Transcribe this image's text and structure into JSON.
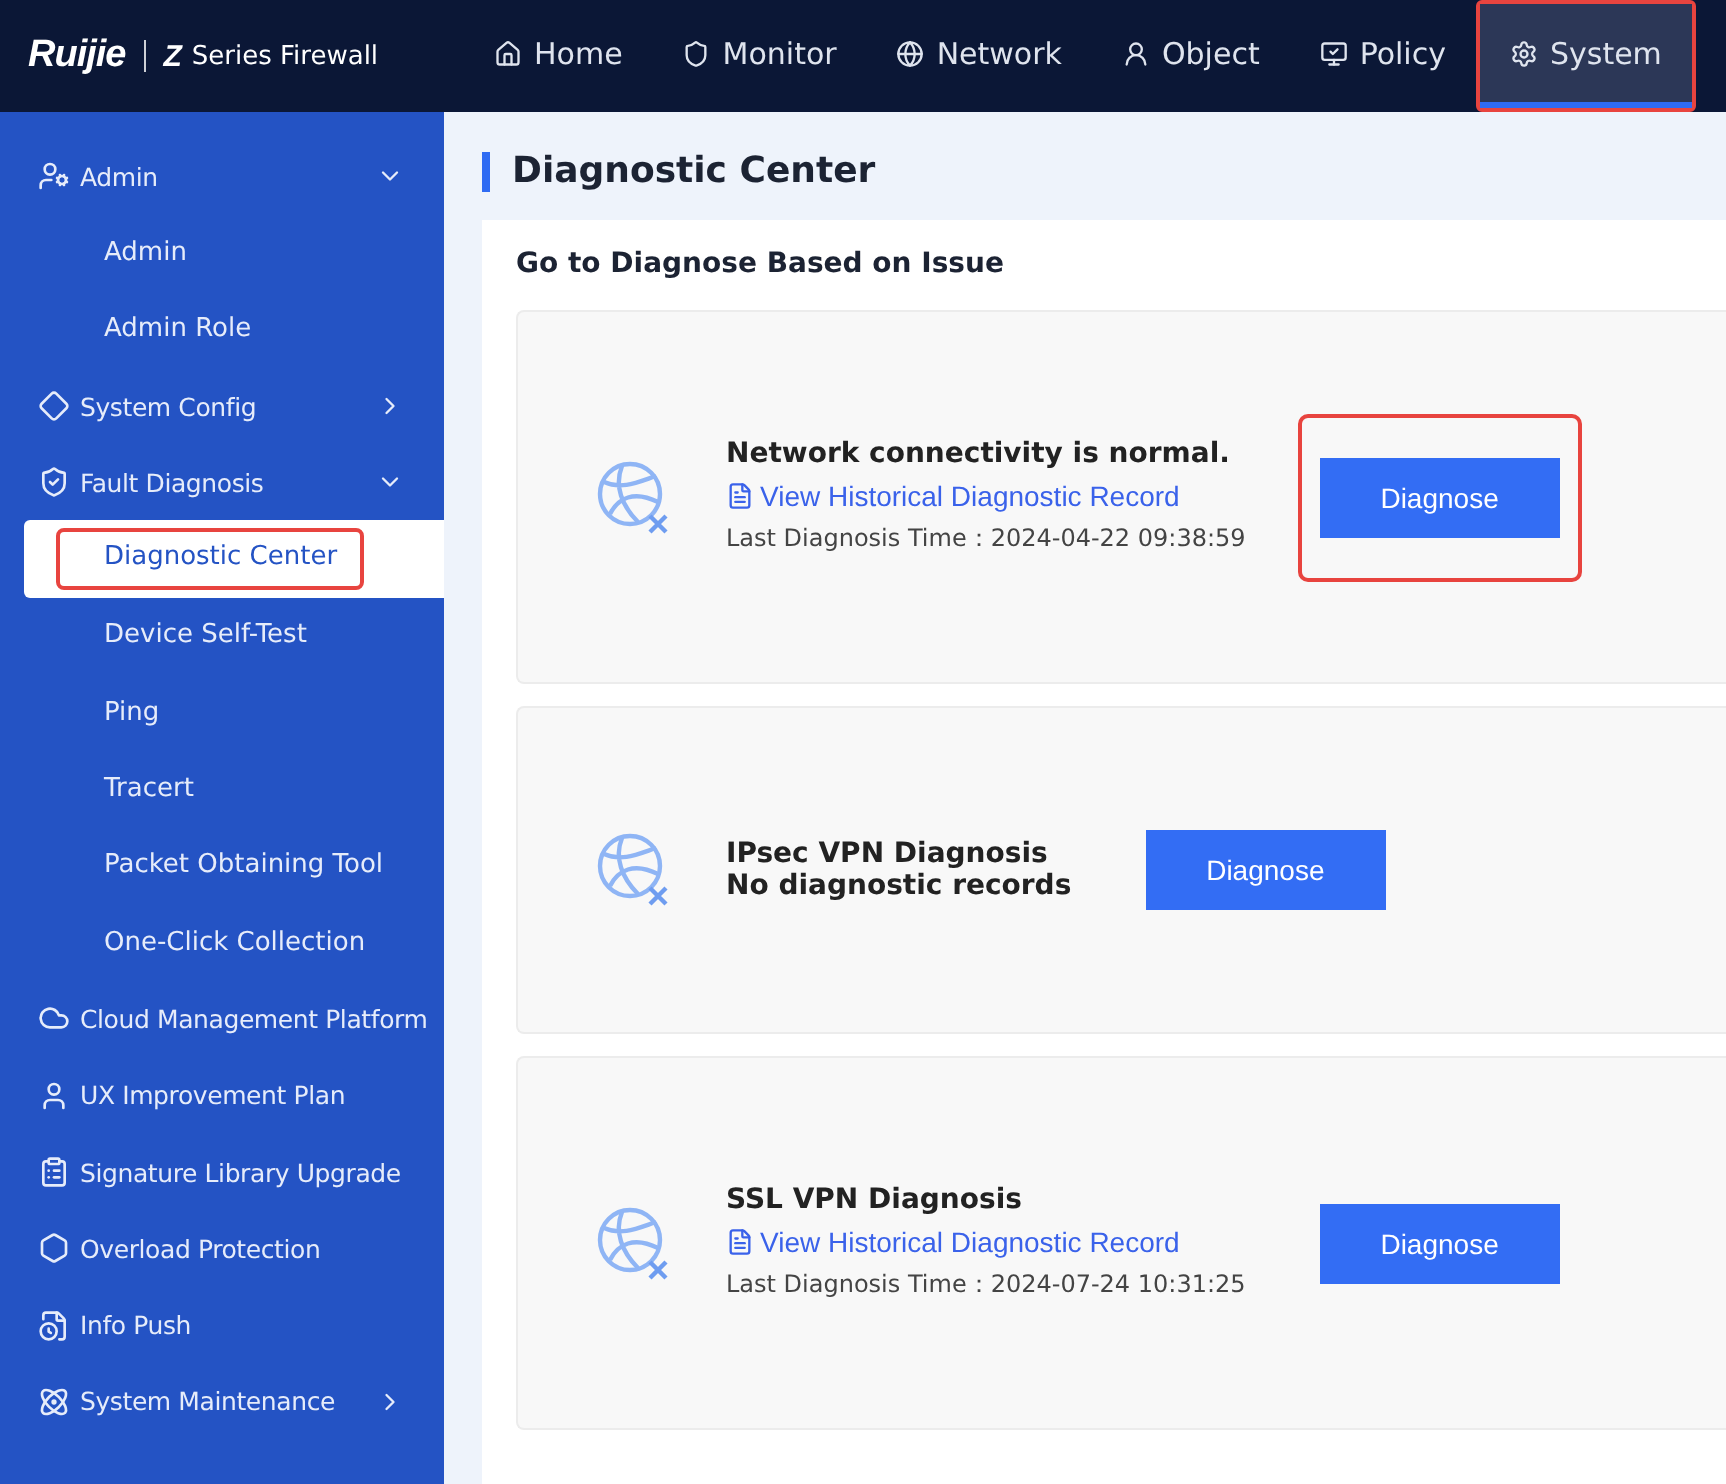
{
  "header": {
    "logo": "Ruijie",
    "product_mark": "Z",
    "product": "Series Firewall"
  },
  "nav": [
    {
      "label": "Home",
      "selected": false,
      "highlighted": false
    },
    {
      "label": "Monitor",
      "selected": false,
      "highlighted": false
    },
    {
      "label": "Network",
      "selected": false,
      "highlighted": false
    },
    {
      "label": "Object",
      "selected": false,
      "highlighted": false
    },
    {
      "label": "Policy",
      "selected": false,
      "highlighted": false
    },
    {
      "label": "System",
      "selected": true,
      "highlighted": true
    }
  ],
  "sidebar": [
    {
      "kind": "group",
      "label": "Admin",
      "expanded": true,
      "children": [
        {
          "label": "Admin",
          "selected": false,
          "highlighted": false
        },
        {
          "label": "Admin Role",
          "selected": false,
          "highlighted": false
        }
      ]
    },
    {
      "kind": "group",
      "label": "System Config",
      "expanded": false
    },
    {
      "kind": "group",
      "label": "Fault Diagnosis",
      "expanded": true,
      "children": [
        {
          "label": "Diagnostic Center",
          "selected": true,
          "highlighted": true
        },
        {
          "label": "Device Self-Test",
          "selected": false,
          "highlighted": false
        },
        {
          "label": "Ping",
          "selected": false,
          "highlighted": false
        },
        {
          "label": "Tracert",
          "selected": false,
          "highlighted": false
        },
        {
          "label": "Packet Obtaining Tool",
          "selected": false,
          "highlighted": false
        },
        {
          "label": "One-Click Collection",
          "selected": false,
          "highlighted": false
        }
      ]
    },
    {
      "kind": "item",
      "label": "Cloud Management Platform"
    },
    {
      "kind": "item",
      "label": "UX Improvement Plan"
    },
    {
      "kind": "item",
      "label": "Signature Library Upgrade"
    },
    {
      "kind": "item",
      "label": "Overload Protection"
    },
    {
      "kind": "item",
      "label": "Info Push"
    },
    {
      "kind": "group",
      "label": "System Maintenance",
      "expanded": false
    }
  ],
  "page_title": "Diagnostic Center",
  "section_title": "Go to Diagnose Based on Issue",
  "cards": [
    {
      "title": "Network connectivity is normal.",
      "history_link": "View Historical Diagnostic Record",
      "last_time_label": "Last Diagnosis Time：",
      "last_time": "2024-04-22 09:38:59",
      "button": "Diagnose",
      "highlighted": true
    },
    {
      "title": "IPsec VPN Diagnosis",
      "status": "No diagnostic records",
      "button": "Diagnose",
      "highlighted": false
    },
    {
      "title": "SSL VPN Diagnosis",
      "history_link": "View Historical Diagnostic Record",
      "last_time_label": "Last Diagnosis Time：",
      "last_time": "2024-07-24 10:31:25",
      "button": "Diagnose",
      "highlighted": false
    }
  ]
}
